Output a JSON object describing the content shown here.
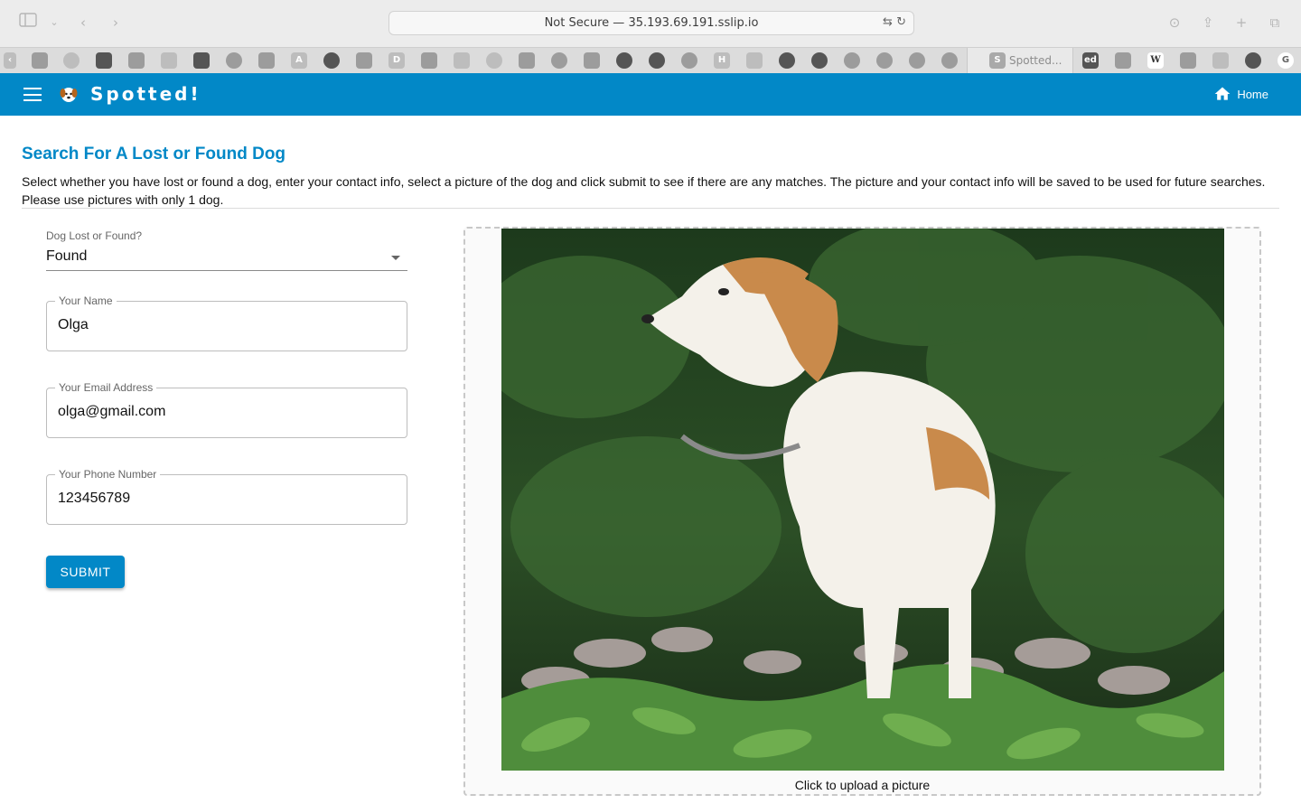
{
  "browser": {
    "address": "Not Secure — 35.193.69.191.sslip.io",
    "active_tab_label": "Spotted...",
    "favicon_letters": [
      "A",
      "D",
      "H",
      "ed",
      "W",
      "G",
      "S"
    ]
  },
  "appbar": {
    "brand": "Spotted!",
    "home_label": "Home",
    "color": "#0288c7"
  },
  "page": {
    "title": "Search For A Lost or Found Dog",
    "description": "Select whether you have lost or found a dog, enter your contact info, select a picture of the dog and click submit to see if there are any matches. The picture and your contact info will be saved to be used for future searches. Please use pictures with only 1 dog."
  },
  "form": {
    "lost_found_label": "Dog Lost or Found?",
    "lost_found_value": "Found",
    "name_label": "Your Name",
    "name_value": "Olga",
    "email_label": "Your Email Address",
    "email_value": "olga@gmail.com",
    "phone_label": "Your Phone Number",
    "phone_value": "123456789",
    "submit_label": "SUBMIT"
  },
  "upload": {
    "caption": "Click to upload a picture"
  }
}
